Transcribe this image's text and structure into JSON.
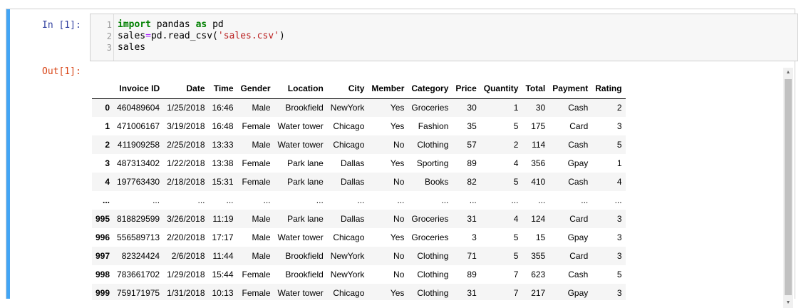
{
  "input_cell": {
    "prompt": "In [1]:",
    "line_numbers": [
      "1",
      "2",
      "3"
    ],
    "code": {
      "line1": {
        "kw1": "import",
        "t1": " pandas ",
        "kw2": "as",
        "t2": " pd"
      },
      "line2": {
        "t1": "sales",
        "op": "=",
        "t2": "pd.read_csv(",
        "str": "'sales.csv'",
        "t3": ")"
      },
      "line3": {
        "t1": "sales"
      }
    }
  },
  "output_cell": {
    "prompt": "Out[1]:",
    "columns": [
      "Invoice ID",
      "Date",
      "Time",
      "Gender",
      "Location",
      "City",
      "Member",
      "Category",
      "Price",
      "Quantity",
      "Total",
      "Payment",
      "Rating"
    ],
    "rows": [
      {
        "index": "0",
        "cells": [
          "460489604",
          "1/25/2018",
          "16:46",
          "Male",
          "Brookfield",
          "NewYork",
          "Yes",
          "Groceries",
          "30",
          "1",
          "30",
          "Cash",
          "2"
        ]
      },
      {
        "index": "1",
        "cells": [
          "471006167",
          "3/19/2018",
          "16:48",
          "Female",
          "Water tower",
          "Chicago",
          "Yes",
          "Fashion",
          "35",
          "5",
          "175",
          "Card",
          "3"
        ]
      },
      {
        "index": "2",
        "cells": [
          "411909258",
          "2/25/2018",
          "13:33",
          "Male",
          "Water tower",
          "Chicago",
          "No",
          "Clothing",
          "57",
          "2",
          "114",
          "Cash",
          "5"
        ]
      },
      {
        "index": "3",
        "cells": [
          "487313402",
          "1/22/2018",
          "13:38",
          "Female",
          "Park lane",
          "Dallas",
          "Yes",
          "Sporting",
          "89",
          "4",
          "356",
          "Gpay",
          "1"
        ]
      },
      {
        "index": "4",
        "cells": [
          "197763430",
          "2/18/2018",
          "15:31",
          "Female",
          "Park lane",
          "Dallas",
          "No",
          "Books",
          "82",
          "5",
          "410",
          "Cash",
          "4"
        ]
      },
      {
        "index": "...",
        "cells": [
          "...",
          "...",
          "...",
          "...",
          "...",
          "...",
          "...",
          "...",
          "...",
          "...",
          "...",
          "...",
          "..."
        ]
      },
      {
        "index": "995",
        "cells": [
          "818829599",
          "3/26/2018",
          "11:19",
          "Male",
          "Park lane",
          "Dallas",
          "No",
          "Groceries",
          "31",
          "4",
          "124",
          "Card",
          "3"
        ]
      },
      {
        "index": "996",
        "cells": [
          "556589713",
          "2/20/2018",
          "17:17",
          "Male",
          "Water tower",
          "Chicago",
          "Yes",
          "Groceries",
          "3",
          "5",
          "15",
          "Gpay",
          "3"
        ]
      },
      {
        "index": "997",
        "cells": [
          "82324424",
          "2/6/2018",
          "11:44",
          "Male",
          "Brookfield",
          "NewYork",
          "No",
          "Clothing",
          "71",
          "5",
          "355",
          "Card",
          "3"
        ]
      },
      {
        "index": "998",
        "cells": [
          "783661702",
          "1/29/2018",
          "15:44",
          "Female",
          "Brookfield",
          "NewYork",
          "No",
          "Clothing",
          "89",
          "7",
          "623",
          "Cash",
          "5"
        ]
      },
      {
        "index": "999",
        "cells": [
          "759171975",
          "1/31/2018",
          "10:13",
          "Female",
          "Water tower",
          "Chicago",
          "Yes",
          "Clothing",
          "31",
          "7",
          "217",
          "Gpay",
          "3"
        ]
      }
    ]
  },
  "icons": {
    "scroll_up": "up-arrow-icon",
    "scroll_down": "down-arrow-icon"
  },
  "colors": {
    "cell_selected_bar": "#42a5f5",
    "prompt_in": "#303f9f",
    "prompt_out": "#d84315",
    "keyword": "#008000",
    "string": "#ba2121",
    "operator": "#aa22ff"
  }
}
